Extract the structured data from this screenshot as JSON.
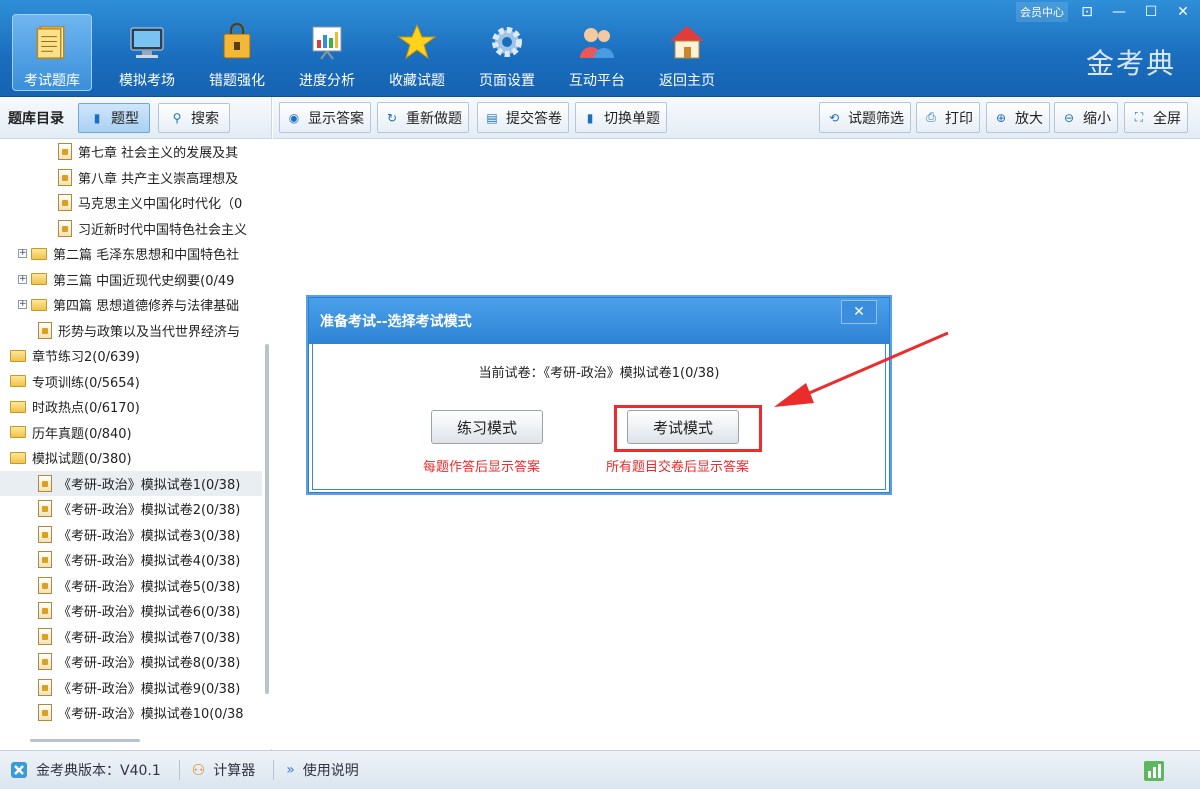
{
  "app": {
    "brand": "金考典",
    "member_label": "会员中心",
    "controls": [
      "⊡",
      "—",
      "☐",
      "✕"
    ]
  },
  "nav": {
    "items": [
      {
        "label": "考试题库",
        "icon": "notebook-icon",
        "active": true
      },
      {
        "label": "模拟考场",
        "icon": "computer-icon"
      },
      {
        "label": "错题强化",
        "icon": "lock-bag-icon"
      },
      {
        "label": "进度分析",
        "icon": "chart-board-icon"
      },
      {
        "label": "收藏试题",
        "icon": "star-icon"
      },
      {
        "label": "页面设置",
        "icon": "gear-icon"
      },
      {
        "label": "互动平台",
        "icon": "people-icon"
      },
      {
        "label": "返回主页",
        "icon": "home-icon"
      }
    ]
  },
  "left_toolbar": {
    "title": "题库目录",
    "type_label": "题型",
    "search_label": "搜索"
  },
  "tree": {
    "rows": [
      {
        "label": "第七章 社会主义的发展及其",
        "indent": 58,
        "kind": "doc"
      },
      {
        "label": "第八章 共产主义崇高理想及",
        "indent": 58,
        "kind": "doc"
      },
      {
        "label": "马克思主义中国化时代化（0",
        "indent": 58,
        "kind": "doc"
      },
      {
        "label": "习近新时代中国特色社会主义",
        "indent": 58,
        "kind": "doc"
      },
      {
        "label": "第二篇 毛泽东思想和中国特色社",
        "indent": 18,
        "kind": "folder-plus"
      },
      {
        "label": "第三篇 中国近现代史纲要(0/49",
        "indent": 18,
        "kind": "folder-plus"
      },
      {
        "label": "第四篇 思想道德修养与法律基础",
        "indent": 18,
        "kind": "folder-plus"
      },
      {
        "label": "形势与政策以及当代世界经济与",
        "indent": 38,
        "kind": "doc"
      },
      {
        "label": "章节练习2(0/639)",
        "indent": 10,
        "kind": "folder"
      },
      {
        "label": "专项训练(0/5654)",
        "indent": 10,
        "kind": "folder"
      },
      {
        "label": "时政热点(0/6170)",
        "indent": 10,
        "kind": "folder"
      },
      {
        "label": "历年真题(0/840)",
        "indent": 10,
        "kind": "folder"
      },
      {
        "label": "模拟试题(0/380)",
        "indent": 10,
        "kind": "folder"
      },
      {
        "label": "《考研-政治》模拟试卷1(0/38)",
        "indent": 38,
        "kind": "doc",
        "selected": true
      },
      {
        "label": "《考研-政治》模拟试卷2(0/38)",
        "indent": 38,
        "kind": "doc"
      },
      {
        "label": "《考研-政治》模拟试卷3(0/38)",
        "indent": 38,
        "kind": "doc"
      },
      {
        "label": "《考研-政治》模拟试卷4(0/38)",
        "indent": 38,
        "kind": "doc"
      },
      {
        "label": "《考研-政治》模拟试卷5(0/38)",
        "indent": 38,
        "kind": "doc"
      },
      {
        "label": "《考研-政治》模拟试卷6(0/38)",
        "indent": 38,
        "kind": "doc"
      },
      {
        "label": "《考研-政治》模拟试卷7(0/38)",
        "indent": 38,
        "kind": "doc"
      },
      {
        "label": "《考研-政治》模拟试卷8(0/38)",
        "indent": 38,
        "kind": "doc"
      },
      {
        "label": "《考研-政治》模拟试卷9(0/38)",
        "indent": 38,
        "kind": "doc"
      },
      {
        "label": "《考研-政治》模拟试卷10(0/38",
        "indent": 38,
        "kind": "doc"
      }
    ]
  },
  "toolbar": {
    "show_answer": "显示答案",
    "redo": "重新做题",
    "submit": "提交答卷",
    "switch_single": "切换单题",
    "filter": "试题筛选",
    "print": "打印",
    "zoom_in": "放大",
    "zoom_out": "缩小",
    "fullscreen": "全屏"
  },
  "dialog": {
    "title": "准备考试--选择考试模式",
    "close": "✕",
    "current_paper": "当前试卷：《考研-政治》模拟试卷1(0/38)",
    "practice_mode": "练习模式",
    "practice_hint": "每题作答后显示答案",
    "exam_mode": "考试模式",
    "exam_hint": "所有题目交卷后显示答案"
  },
  "status": {
    "version": "金考典版本：V40.1",
    "calculator": "计算器",
    "manual": "使用说明"
  },
  "colors": {
    "header_blue": "#1a6dbd",
    "annotation_red": "#ec2b2b",
    "hint_red": "#ee2a2a"
  }
}
